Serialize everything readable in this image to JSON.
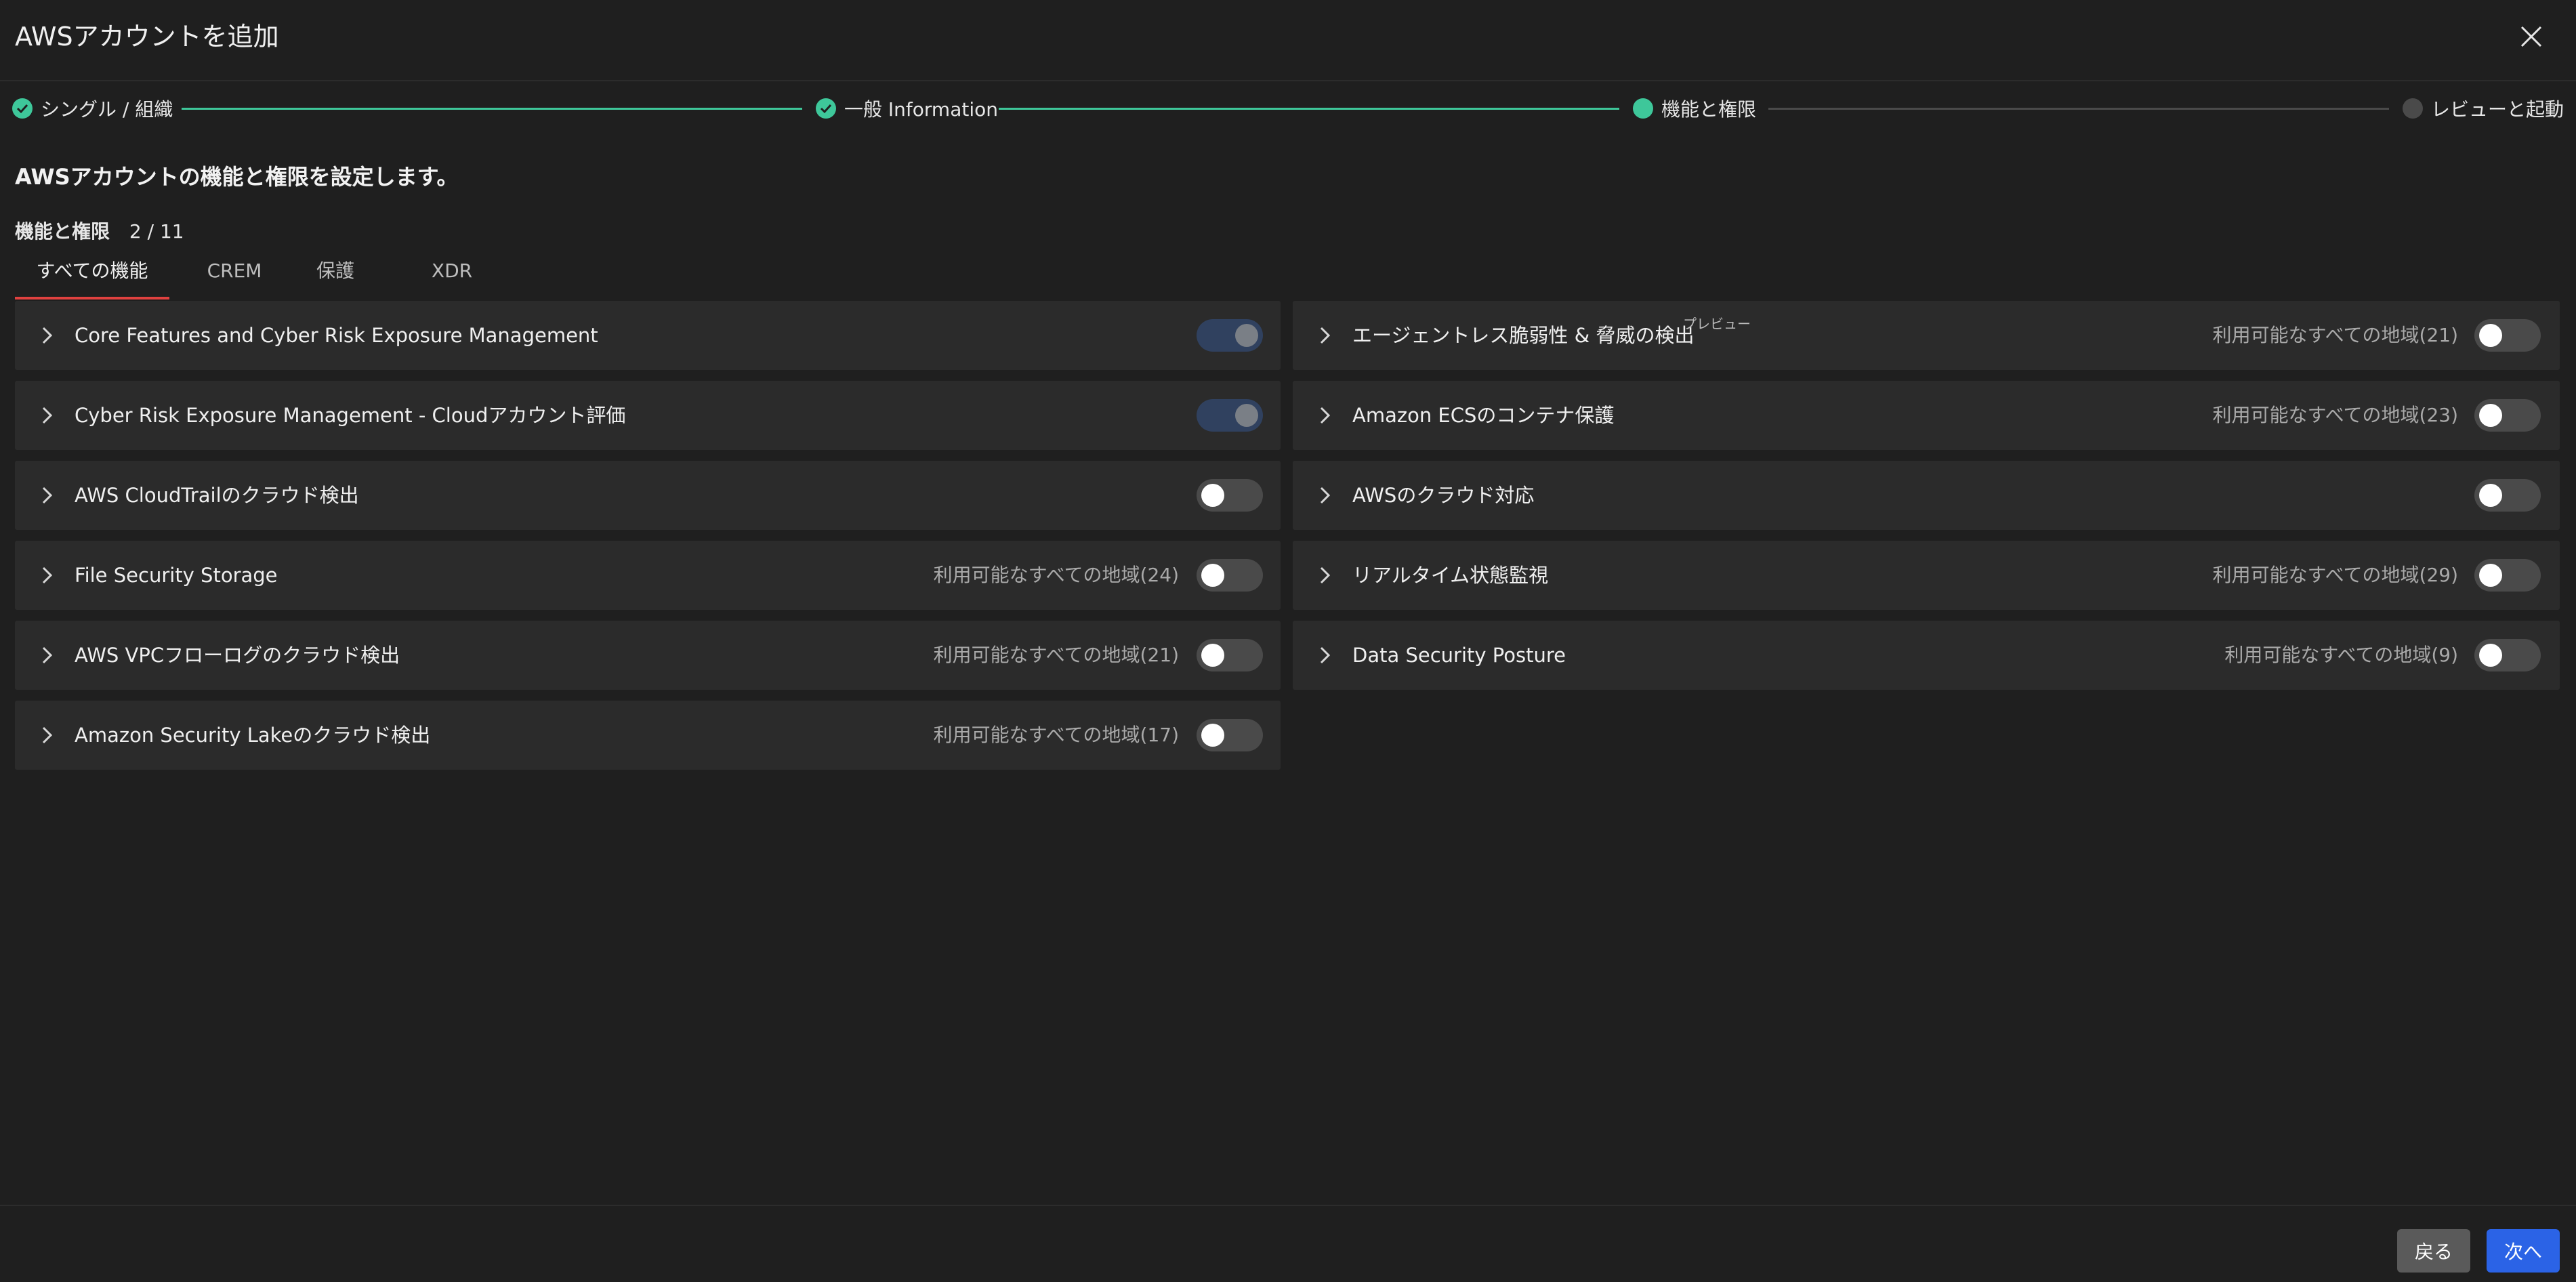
{
  "header": {
    "title": "AWSアカウントを追加",
    "close_icon": "close-icon"
  },
  "stepper": {
    "steps": [
      {
        "label": "シングル / 組織",
        "status": "done"
      },
      {
        "label": "一般 Information",
        "status": "done"
      },
      {
        "label": "機能と権限",
        "status": "current"
      },
      {
        "label": "レビューと起動",
        "status": "pending"
      }
    ]
  },
  "intro": {
    "heading": "AWSアカウントの機能と権限を設定します。",
    "perm_label": "機能と権限",
    "perm_count": "2 / 11"
  },
  "tabs": [
    {
      "label": "すべての機能",
      "active": true
    },
    {
      "label": "CREM",
      "active": false
    },
    {
      "label": "保護",
      "active": false
    },
    {
      "label": "XDR",
      "active": false
    }
  ],
  "features_left": [
    {
      "name": "Core Features and Cyber Risk Exposure Management",
      "region": "",
      "enabled": true
    },
    {
      "name": "Cyber Risk Exposure Management - Cloudアカウント評価",
      "region": "",
      "enabled": true
    },
    {
      "name": "AWS CloudTrailのクラウド検出",
      "region": "",
      "enabled": false
    },
    {
      "name": "File Security Storage",
      "region": "利用可能なすべての地域(24)",
      "enabled": false
    },
    {
      "name": "AWS VPCフローログのクラウド検出",
      "region": "利用可能なすべての地域(21)",
      "enabled": false
    },
    {
      "name": "Amazon Security Lakeのクラウド検出",
      "region": "利用可能なすべての地域(17)",
      "enabled": false
    }
  ],
  "features_right": [
    {
      "name": "エージェントレス脆弱性 & 脅威の検出",
      "tag": "プレビュー",
      "region": "利用可能なすべての地域(21)",
      "enabled": false
    },
    {
      "name": "Amazon ECSのコンテナ保護",
      "region": "利用可能なすべての地域(23)",
      "enabled": false
    },
    {
      "name": "AWSのクラウド対応",
      "region": "",
      "enabled": false
    },
    {
      "name": "リアルタイム状態監視",
      "region": "利用可能なすべての地域(29)",
      "enabled": false
    },
    {
      "name": "Data Security Posture",
      "region": "利用可能なすべての地域(9)",
      "enabled": false
    }
  ],
  "footer": {
    "back_label": "戻る",
    "next_label": "次へ"
  },
  "colors": {
    "accent_green": "#3ec79a",
    "tab_underline": "#e0413f",
    "primary_button": "#2b63e6",
    "toggle_on": "#30415f"
  }
}
